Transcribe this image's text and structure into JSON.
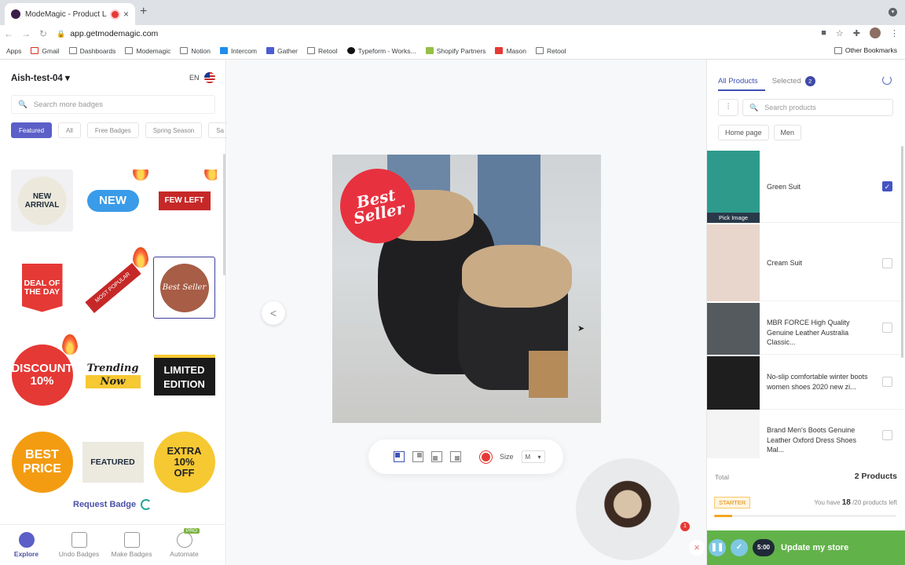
{
  "browser": {
    "tab_title": "ModeMagic - Product Labe",
    "tab_close": "×",
    "new_tab": "+",
    "url": "app.getmodemagic.com",
    "bookmarks": [
      "Apps",
      "Gmail",
      "Dashboards",
      "Modemagic",
      "Notion",
      "Intercom",
      "Gather",
      "Retool",
      "Typeform - Works...",
      "Shopify Partners",
      "Mason",
      "Retool"
    ],
    "other_bookmarks": "Other Bookmarks"
  },
  "left": {
    "store_name": "Aish-test-04 ▾",
    "lang": "EN",
    "search_placeholder": "Search more badges",
    "chips": [
      "Featured",
      "All",
      "Free Badges",
      "Spring Season",
      "Sa"
    ],
    "badges": [
      "NEW ARRIVAL",
      "NEW",
      "FEW LEFT",
      "DEAL OF THE DAY",
      "MOST POPULAR",
      "Best Seller",
      "DISCOUNT 10%",
      "Trending Now",
      "LIMITED EDITION",
      "BEST PRICE",
      "FEATURED",
      "EXTRA 10% OFF"
    ],
    "request_badge": "Request Badge",
    "nav": [
      "Explore",
      "Undo Badges",
      "Make Badges",
      "Automate"
    ],
    "pro": "PRO"
  },
  "center": {
    "badge_text": "Best Seller",
    "size_label": "Size",
    "size_value": "M",
    "notif_count": "1",
    "prev_arrow": "<",
    "cam_close": "×"
  },
  "right": {
    "tab_all": "All Products",
    "tab_selected": "Selected",
    "selected_count": "2",
    "search_placeholder": "Search products",
    "chips": [
      "Home page",
      "Men"
    ],
    "products": [
      {
        "name": "Green Suit",
        "checked": true,
        "thumb": "#2e9a8c"
      },
      {
        "name": "Cream Suit",
        "checked": false,
        "thumb": "#e8d6cc"
      },
      {
        "name": "MBR FORCE High Quality Genuine Leather Australia Classic...",
        "checked": false,
        "thumb": "#555a5e"
      },
      {
        "name": "No-slip comfortable winter boots women shoes 2020 new zi...",
        "checked": false,
        "thumb": "#1e1e1e"
      },
      {
        "name": "Brand Men's Boots Genuine Leather Oxford Dress Shoes Mal...",
        "checked": false,
        "thumb": "#f4f4f4"
      }
    ],
    "pick_image": "Pick Image",
    "total_label": "Total",
    "total_value": "2 Products",
    "plan": "STARTER",
    "plan_prefix": "You have ",
    "plan_count": "18",
    "plan_suffix": " /20 products left",
    "plan_progress": 0.1,
    "update_button": "Update my store",
    "timer": "5:00"
  },
  "colors": {
    "accent": "#5b5fc7",
    "primary_green": "#62b24a",
    "badge_red": "#e8313f"
  }
}
